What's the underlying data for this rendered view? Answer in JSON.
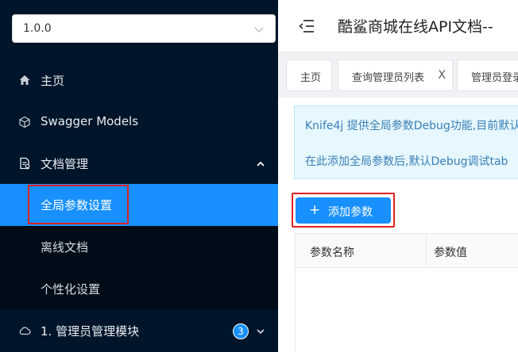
{
  "sidebar": {
    "version": "1.0.0",
    "items": [
      {
        "label": "主页",
        "icon": "home-icon"
      },
      {
        "label": "Swagger Models",
        "icon": "cube-icon"
      },
      {
        "label": "文档管理",
        "icon": "doc-manage-icon"
      }
    ],
    "subitems": [
      {
        "label": "全局参数设置",
        "active": true
      },
      {
        "label": "离线文档"
      },
      {
        "label": "个性化设置"
      }
    ],
    "module": {
      "label": "1. 管理员管理模块",
      "count": "3",
      "icon": "cloud-icon"
    }
  },
  "header": {
    "title": "酷鲨商城在线API文档--"
  },
  "tabs": [
    {
      "label": "主页"
    },
    {
      "label": "查询管理员列表",
      "close": "X"
    },
    {
      "label": "管理员登录"
    }
  ],
  "main": {
    "alert": {
      "line1": "Knife4j 提供全局参数Debug功能,目前默认",
      "line2": "在此添加全局参数后,默认Debug调试tab"
    },
    "add_button": {
      "plus": "+",
      "label": "添加参数"
    },
    "table": {
      "headers": [
        "参数名称",
        "参数值"
      ]
    }
  },
  "colors": {
    "sidebar_bg": "#001529",
    "active_blue": "#1890ff",
    "highlight_red": "#e02020"
  }
}
